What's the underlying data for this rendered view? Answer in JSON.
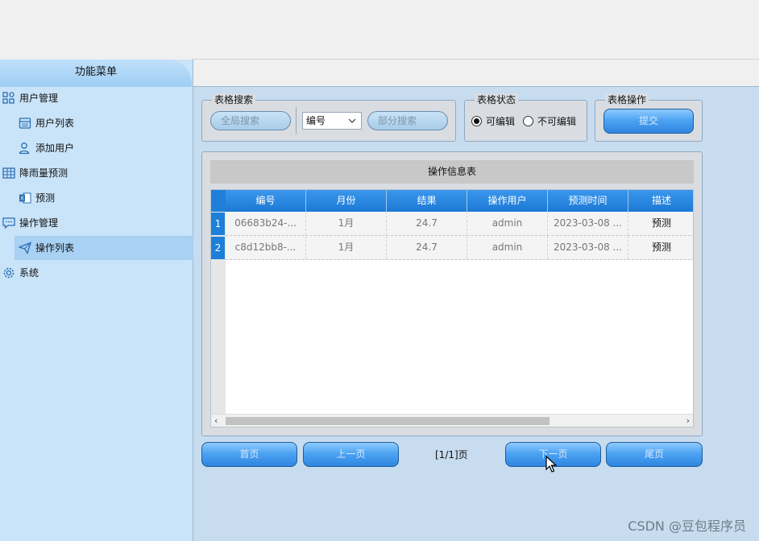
{
  "sidebar": {
    "title": "功能菜单",
    "items": [
      {
        "label": "用户管理",
        "icon": "users-grid-icon",
        "level": 0
      },
      {
        "label": "用户列表",
        "icon": "list-window-icon",
        "level": 1
      },
      {
        "label": "添加用户",
        "icon": "add-user-icon",
        "level": 1
      },
      {
        "label": "降雨量预测",
        "icon": "table-icon",
        "level": 0
      },
      {
        "label": "预测",
        "icon": "excel-icon",
        "level": 1
      },
      {
        "label": "操作管理",
        "icon": "chat-icon",
        "level": 0
      },
      {
        "label": "操作列表",
        "icon": "send-icon",
        "level": 1,
        "selected": true
      },
      {
        "label": "系统",
        "icon": "gear-icon",
        "level": 0
      }
    ]
  },
  "search": {
    "group_title": "表格搜索",
    "global_search_label": "全局搜索",
    "field_select_value": "编号",
    "partial_search_label": "部分搜索"
  },
  "table_state": {
    "group_title": "表格状态",
    "editable_label": "可编辑",
    "not_editable_label": "不可编辑",
    "selected": "editable"
  },
  "table_ops": {
    "group_title": "表格操作",
    "submit_label": "提交"
  },
  "table": {
    "caption": "操作信息表",
    "columns": [
      "编号",
      "月份",
      "结果",
      "操作用户",
      "预测时间",
      "描述"
    ],
    "rows": [
      {
        "num": "1",
        "cells": [
          "06683b24-...",
          "1月",
          "24.7",
          "admin",
          "2023-03-08 ...",
          "预测"
        ]
      },
      {
        "num": "2",
        "cells": [
          "c8d12bb8-...",
          "1月",
          "24.7",
          "admin",
          "2023-03-08 ...",
          "预测"
        ]
      }
    ]
  },
  "pagination": {
    "first_label": "首页",
    "prev_label": "上一页",
    "page_info": "[1/1]页",
    "next_label": "下一页",
    "last_label": "尾页"
  },
  "watermark": "CSDN @豆包程序员",
  "colors": {
    "accent": "#1e7fd9",
    "sidebar_bg": "#c9e3f8",
    "main_bg": "#c7dcef"
  }
}
